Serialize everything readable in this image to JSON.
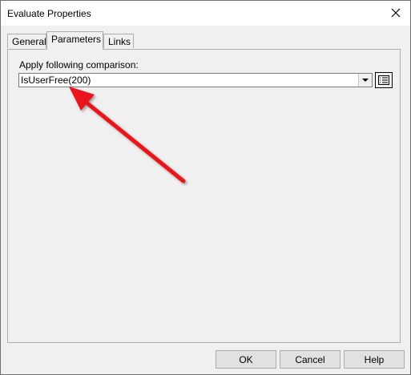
{
  "window": {
    "title": "Evaluate Properties"
  },
  "tabs": [
    {
      "label": "General",
      "active": false
    },
    {
      "label": "Parameters",
      "active": true
    },
    {
      "label": "Links",
      "active": false
    }
  ],
  "parameters": {
    "comparison_label": "Apply following comparison:",
    "comparison_value": "IsUserFree(200)"
  },
  "buttons": {
    "ok": "OK",
    "cancel": "Cancel",
    "help": "Help"
  },
  "colors": {
    "annotation_arrow": "#e8181b"
  }
}
